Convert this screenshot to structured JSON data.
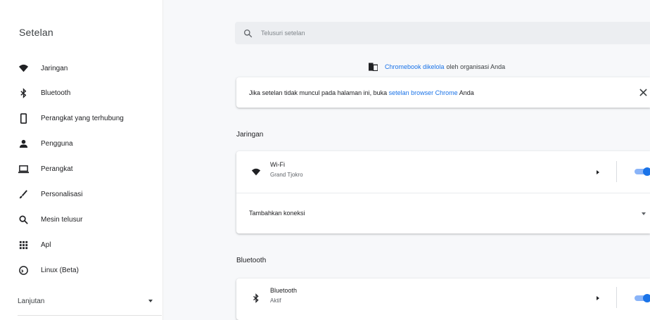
{
  "sidebar": {
    "title": "Setelan",
    "items": [
      {
        "label": "Jaringan",
        "icon": "wifi-icon"
      },
      {
        "label": "Bluetooth",
        "icon": "bluetooth-icon"
      },
      {
        "label": "Perangkat yang terhubung",
        "icon": "phone-icon"
      },
      {
        "label": "Pengguna",
        "icon": "person-icon"
      },
      {
        "label": "Perangkat",
        "icon": "laptop-icon"
      },
      {
        "label": "Personalisasi",
        "icon": "brush-icon"
      },
      {
        "label": "Mesin telusur",
        "icon": "search-icon"
      },
      {
        "label": "Apl",
        "icon": "apps-grid-icon"
      },
      {
        "label": "Linux (Beta)",
        "icon": "terminal-icon"
      }
    ],
    "advanced_label": "Lanjutan"
  },
  "search": {
    "placeholder": "Telusuri setelan"
  },
  "managed": {
    "link": "Chromebook dikelola",
    "text": "oleh organisasi Anda"
  },
  "notice": {
    "text_before": "Jika setelan tidak muncul pada halaman ini, buka",
    "link": "setelan browser Chrome",
    "text_after": "Anda"
  },
  "network": {
    "section_title": "Jaringan",
    "wifi_title": "Wi-Fi",
    "wifi_network": "Grand Tjokro",
    "wifi_enabled": true,
    "add_connection_label": "Tambahkan koneksi"
  },
  "bluetooth": {
    "section_title": "Bluetooth",
    "title": "Bluetooth",
    "status": "Aktif",
    "enabled": true
  },
  "colors": {
    "accent": "#1a73e8",
    "toggle_track": "#8ab4f8",
    "background": "#f7f8fa"
  }
}
